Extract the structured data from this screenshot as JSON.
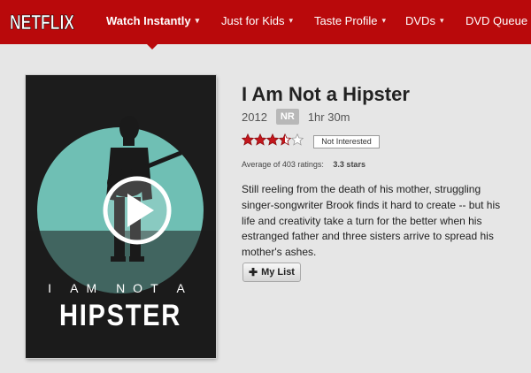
{
  "brand": {
    "logo_text": "NETFLIX",
    "color": "#b9090b"
  },
  "nav": {
    "items": [
      {
        "label": "Watch Instantly",
        "active": true
      },
      {
        "label": "Just for Kids"
      },
      {
        "label": "Taste Profile"
      },
      {
        "label": "DVDs"
      },
      {
        "label": "DVD Queue"
      }
    ],
    "caret": "▾"
  },
  "movie": {
    "title": "I Am Not a Hipster",
    "year": "2012",
    "rating_badge": "NR",
    "duration": "1hr 30m",
    "user_rating": 3.5,
    "not_interested_label": "Not Interested",
    "average_text": "Average of 403 ratings:",
    "average_stars": "3.3 stars",
    "synopsis": "Still reeling from the death of his mother, struggling singer-songwriter Brook finds it hard to create -- but his life and creativity take a turn for the better when his estranged father and three sisters arrive to spread his mother's ashes.",
    "my_list_label": "My List",
    "poster": {
      "line1": "I AM NOT A",
      "line2": "HIPSTER",
      "circle_color": "#6fbfb4",
      "bg_color": "#1c1c1c"
    }
  }
}
